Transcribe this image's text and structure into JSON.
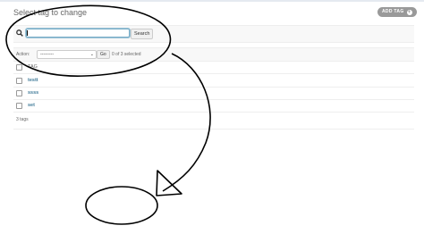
{
  "header": {
    "title": "Select tag to change",
    "add_button_label": "ADD TAG",
    "add_button_icon": "plus-icon"
  },
  "search": {
    "value": "",
    "placeholder": "",
    "button_label": "Search",
    "icon": "search-icon"
  },
  "actions": {
    "label": "Action:",
    "selected_option": "---------",
    "go_label": "Go",
    "selected_count": "0 of 3 selected"
  },
  "table": {
    "header_label": "TAG",
    "rows": [
      {
        "label": "testt"
      },
      {
        "label": "ssss"
      },
      {
        "label": "set"
      }
    ]
  },
  "footer": {
    "result_count": "3 tags"
  },
  "colors": {
    "link": "#447e9b",
    "focus": "#79aec8",
    "add_button_bg": "#999999"
  }
}
